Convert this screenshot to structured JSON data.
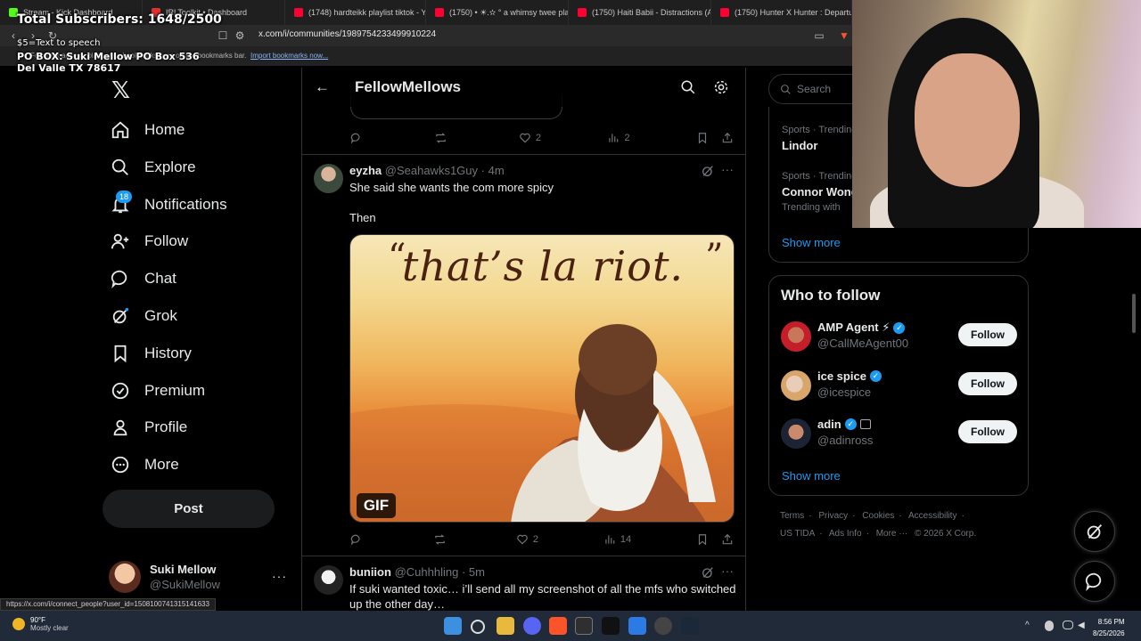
{
  "overlays": {
    "subscribers": "Total Subscribers: 1648/2500",
    "tts": "$5=Text to speech",
    "po_box_line1": "PO BOX: Suki Mellow PO Box 536",
    "po_box_line2": "Del Valle TX 78617"
  },
  "browser": {
    "tabs": [
      {
        "label": "Stream - Kick Dashboard",
        "color": "#53fc18"
      },
      {
        "label": "IRLToolkit • Dashboard",
        "color": "#e03131"
      },
      {
        "label": "(1748) hardteikk playlist tiktok - You",
        "color": "#ff0033"
      },
      {
        "label": "(1750) • ☀︎.✫ ° a whimsy twee pla",
        "color": "#ff0033"
      },
      {
        "label": "(1750) Haiti Babii - Distractions (Au",
        "color": "#ff0033"
      },
      {
        "label": "(1750) Hunter X Hunter : Departure",
        "color": "#ff0033"
      }
    ],
    "url": "x.com/i/communities/1989754233499910224",
    "bookmark_hint": "For quick access, place your bookmarks here on the bookmarks bar.",
    "bookmark_import": "Import bookmarks now...",
    "status_url": "https://x.com/i/connect_people?user_id=1508100741315141633"
  },
  "leftnav": {
    "items": [
      {
        "label": "Home",
        "icon": "home-icon"
      },
      {
        "label": "Explore",
        "icon": "search-icon"
      },
      {
        "label": "Notifications",
        "icon": "bell-icon"
      },
      {
        "label": "Follow",
        "icon": "person-plus-icon"
      },
      {
        "label": "Chat",
        "icon": "chat-icon"
      },
      {
        "label": "Grok",
        "icon": "grok-icon"
      },
      {
        "label": "History",
        "icon": "bookmark-icon"
      },
      {
        "label": "Premium",
        "icon": "verified-icon"
      },
      {
        "label": "Profile",
        "icon": "person-icon"
      },
      {
        "label": "More",
        "icon": "more-circle-icon"
      }
    ],
    "notifications_badge": "18",
    "post_label": "Post",
    "account": {
      "name": "Suki Mellow",
      "handle": "@SukiMellow"
    }
  },
  "feed": {
    "title": "FellowMellows",
    "tweet0_actions": {
      "likes": "2",
      "views": "2"
    },
    "tweets": [
      {
        "name": "eyzha",
        "handle": "@Seahawks1Guy",
        "time": "4m",
        "text1": "She said she wants the com more spicy",
        "text2": "Then",
        "gif_caption": "that’s la riot.",
        "gif_tag": "GIF",
        "likes": "2",
        "views": "14"
      },
      {
        "name": "buniion",
        "handle": "@Cuhhhling",
        "time": "5m",
        "text1": "If suki wanted toxic… i’ll send all my screenshot of all the mfs who switched up the other day…"
      }
    ]
  },
  "rightcol": {
    "search_placeholder": "Search",
    "trends": [
      {
        "context": "Sports · Trending",
        "topic": "Lindor"
      },
      {
        "context": "Sports · Trending",
        "topic": "Connor Wong",
        "with": "Trending with"
      }
    ],
    "show_more": "Show more",
    "who_to_follow": "Who to follow",
    "follow_suggestions": [
      {
        "name": "AMP Agent ⚡",
        "handle": "@CallMeAgent00",
        "button": "Follow"
      },
      {
        "name": "ice spice",
        "handle": "@icespice",
        "button": "Follow"
      },
      {
        "name": "adin",
        "handle": "@adinross",
        "button": "Follow"
      }
    ],
    "show_more_2": "Show more",
    "footer_line1": [
      "Terms",
      "·",
      "Privacy",
      "·",
      "Cookies",
      "·",
      "Accessibility",
      "·"
    ],
    "footer_line2": [
      "US TIDA",
      "·",
      "Ads Info",
      "·",
      "More ···",
      "© 2026 X Corp."
    ]
  },
  "taskbar": {
    "temp": "90°F",
    "weather": "Mostly clear",
    "time": "8:56 PM",
    "date": "8/25/2026"
  },
  "colors": {
    "accent": "#1d9bf0",
    "border": "#2f3336",
    "muted": "#71767b"
  }
}
